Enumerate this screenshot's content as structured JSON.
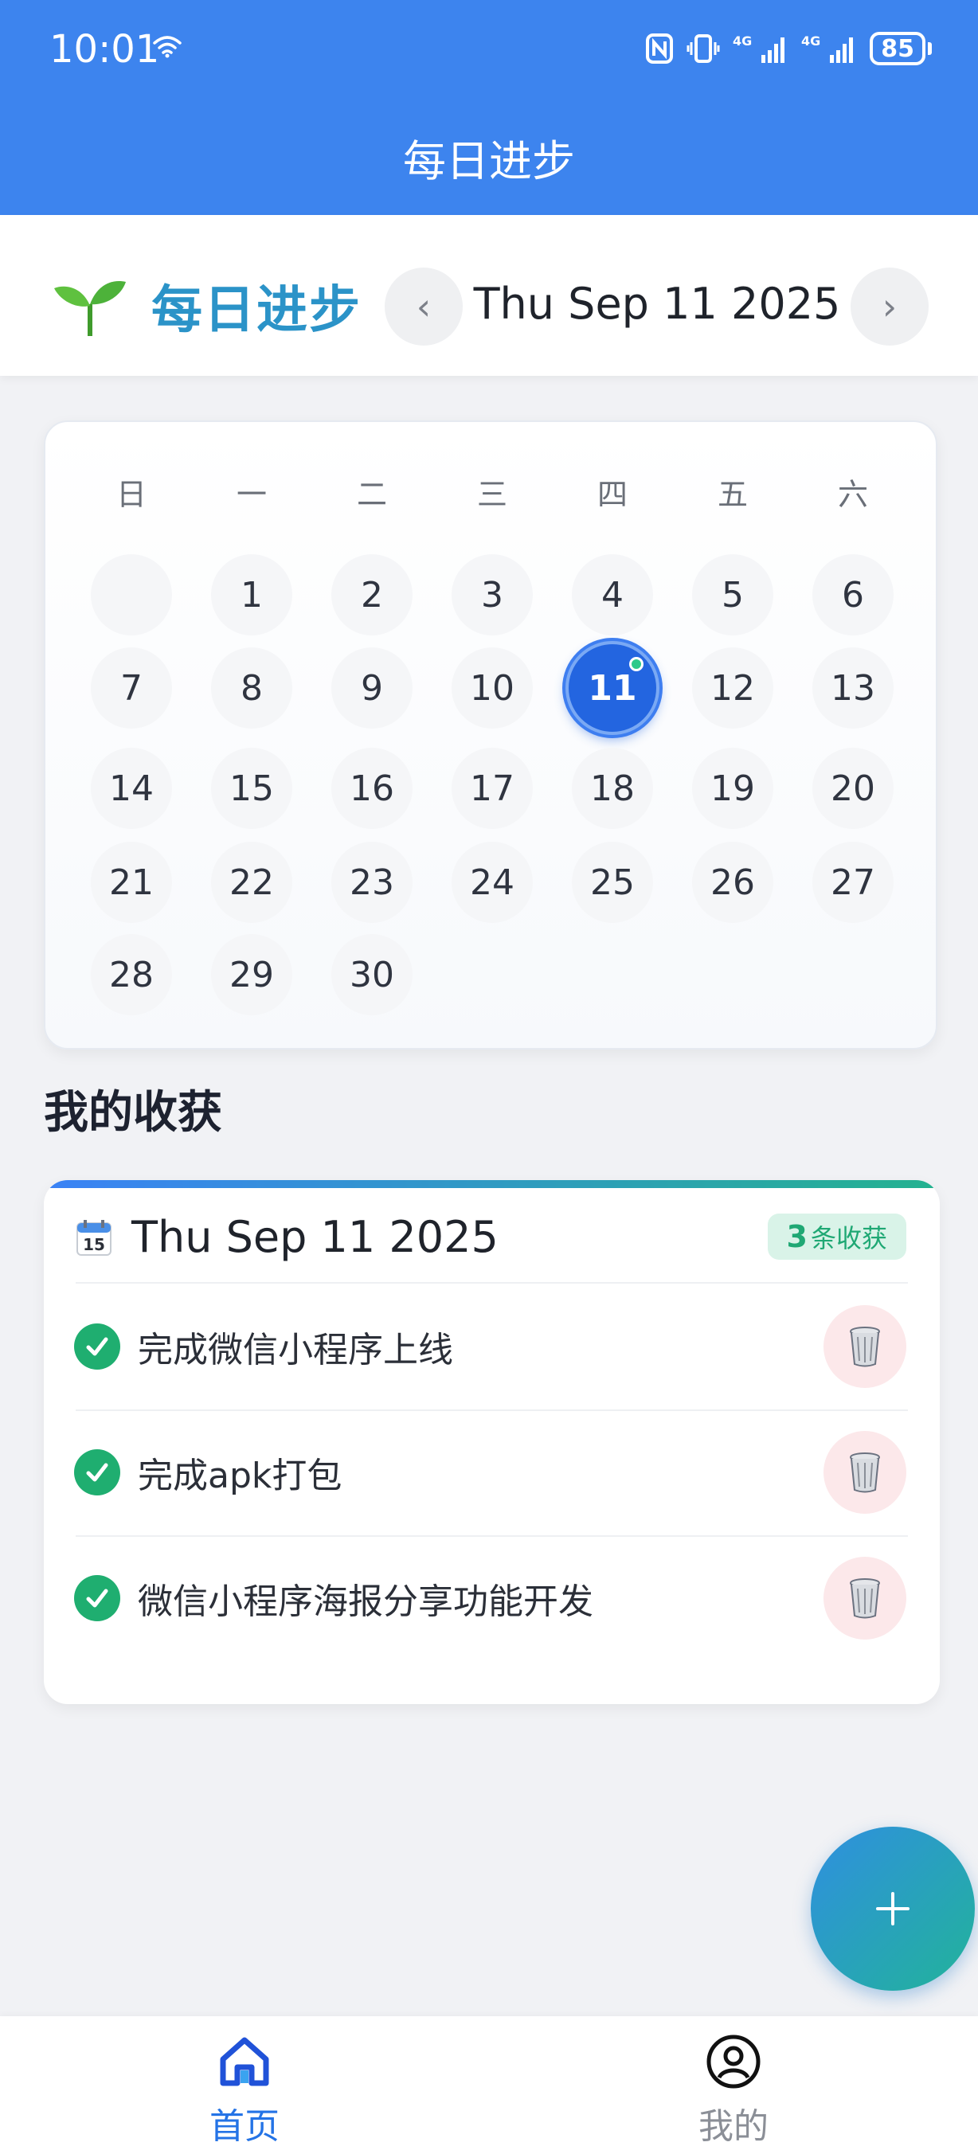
{
  "status_bar": {
    "time": "10:01",
    "battery": "85",
    "network_1": "4G",
    "network_2": "4G"
  },
  "title_bar": {
    "title": "每日进步"
  },
  "header": {
    "brand": "每日进步",
    "brand_icon": "seedling-icon",
    "prev": "‹",
    "next": "›",
    "current_date": "Thu Sep 11 2025"
  },
  "calendar": {
    "weekdays": [
      "日",
      "一",
      "二",
      "三",
      "四",
      "五",
      "六"
    ],
    "days": [
      "1",
      "2",
      "3",
      "4",
      "5",
      "6",
      "7",
      "8",
      "9",
      "10",
      "11",
      "12",
      "13",
      "14",
      "15",
      "16",
      "17",
      "18",
      "19",
      "20",
      "21",
      "22",
      "23",
      "24",
      "25",
      "26",
      "27",
      "28",
      "29",
      "30"
    ],
    "first_weekday_index": 1,
    "selected_day": "11",
    "selected_color": "#2365e0",
    "dot_color": "#2ec98a"
  },
  "harvest": {
    "section_title": "我的收获",
    "date": "Thu Sep 11 2025",
    "badge_count": "3",
    "badge_unit": "条收获",
    "items": [
      {
        "text": "完成微信小程序上线",
        "done": true
      },
      {
        "text": "完成apk打包",
        "done": true
      },
      {
        "text": "微信小程序海报分享功能开发",
        "done": true
      }
    ],
    "accent_start": "#3b82f6",
    "accent_end": "#24b28f"
  },
  "fab": {
    "label": "+"
  },
  "bottom_nav": {
    "tabs": [
      {
        "label": "首页",
        "icon": "home-icon",
        "active": true
      },
      {
        "label": "我的",
        "icon": "user-circle-icon",
        "active": false
      }
    ]
  },
  "colors": {
    "topbar": "#3d84ee",
    "brand": "#2b93c8",
    "active_tab": "#2473e6"
  }
}
